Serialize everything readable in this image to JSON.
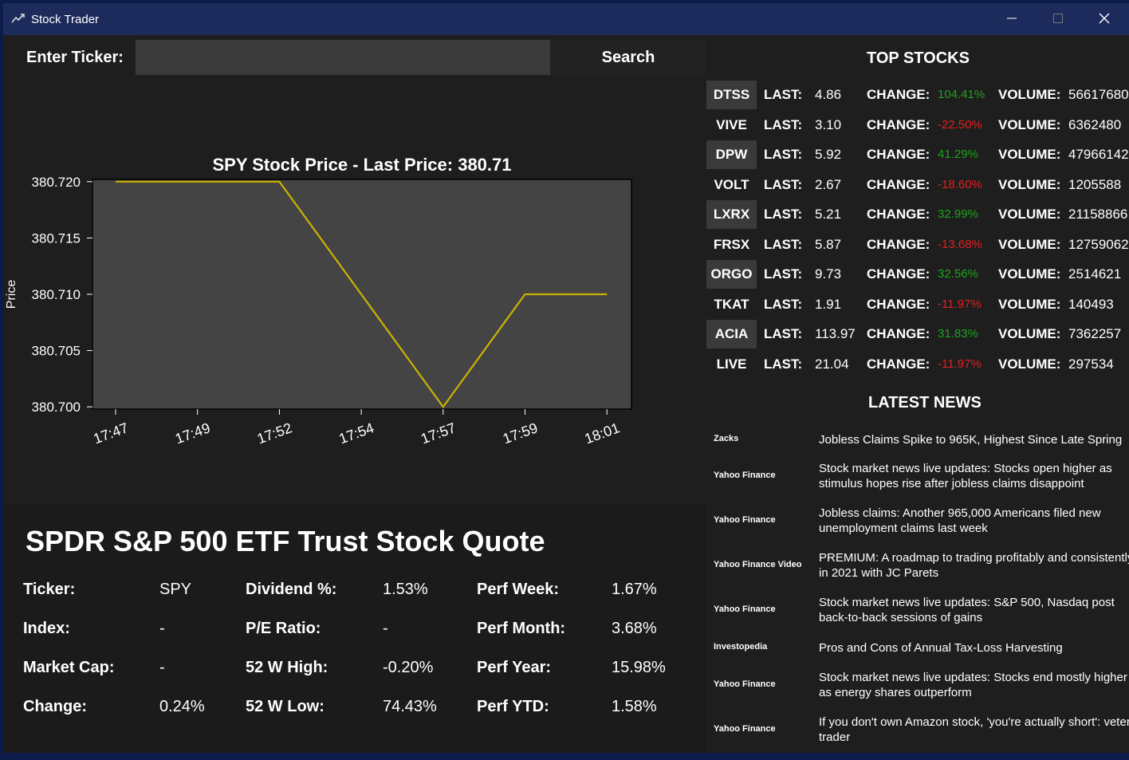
{
  "window": {
    "title": "Stock Trader"
  },
  "search": {
    "label": "Enter Ticker:",
    "value": "",
    "placeholder": "",
    "button": "Search"
  },
  "chart_data": {
    "type": "line",
    "title": "SPY Stock Price - Last Price: 380.71",
    "xlabel": "",
    "ylabel": "Price",
    "x": [
      "17:47",
      "17:49",
      "17:52",
      "17:54",
      "17:57",
      "17:59",
      "18:01"
    ],
    "values": [
      380.72,
      380.72,
      380.72,
      380.71,
      380.7,
      380.71,
      380.71
    ],
    "ylim": [
      380.6998,
      380.7202
    ],
    "yticks": [
      "380.700",
      "380.705",
      "380.710",
      "380.715",
      "380.720"
    ],
    "line_color": "#c8b400",
    "plot_bg": "#444444",
    "grid": false
  },
  "quote": {
    "title": "SPDR S&P 500 ETF Trust Stock Quote",
    "rows": [
      [
        "Ticker:",
        "SPY",
        "Dividend %:",
        "1.53%",
        "Perf Week:",
        "1.67%"
      ],
      [
        "Index:",
        "-",
        "P/E Ratio:",
        "-",
        "Perf Month:",
        "3.68%"
      ],
      [
        "Market Cap:",
        "-",
        "52 W High:",
        "-0.20%",
        "Perf Year:",
        "15.98%"
      ],
      [
        "Change:",
        "0.24%",
        "52 W Low:",
        "74.43%",
        "Perf YTD:",
        "1.58%"
      ]
    ]
  },
  "top_stocks": {
    "title": "TOP STOCKS",
    "last_label": "LAST:",
    "change_label": "CHANGE:",
    "volume_label": "VOLUME:",
    "rows": [
      {
        "symbol": "DTSS",
        "last": "4.86",
        "change": "104.41%",
        "volume": "56617680"
      },
      {
        "symbol": "VIVE",
        "last": "3.10",
        "change": "-22.50%",
        "volume": "6362480"
      },
      {
        "symbol": "DPW",
        "last": "5.92",
        "change": "41.29%",
        "volume": "47966142"
      },
      {
        "symbol": "VOLT",
        "last": "2.67",
        "change": "-18.60%",
        "volume": "1205588"
      },
      {
        "symbol": "LXRX",
        "last": "5.21",
        "change": "32.99%",
        "volume": "21158866"
      },
      {
        "symbol": "FRSX",
        "last": "5.87",
        "change": "-13.68%",
        "volume": "12759062"
      },
      {
        "symbol": "ORGO",
        "last": "9.73",
        "change": "32.56%",
        "volume": "2514621"
      },
      {
        "symbol": "TKAT",
        "last": "1.91",
        "change": "-11.97%",
        "volume": "140493"
      },
      {
        "symbol": "ACIA",
        "last": "113.97",
        "change": "31.83%",
        "volume": "7362257"
      },
      {
        "symbol": "LIVE",
        "last": "21.04",
        "change": "-11.97%",
        "volume": "297534"
      }
    ]
  },
  "news": {
    "title": "LATEST NEWS",
    "items": [
      {
        "source": "Zacks",
        "headline": [
          "Jobless Claims Spike to 965K, Highest Since Late Spring"
        ]
      },
      {
        "source": "Yahoo Finance",
        "headline": [
          "Stock market news live updates: Stocks open higher as",
          "stimulus hopes rise after jobless claims disappoint"
        ]
      },
      {
        "source": "Yahoo Finance",
        "headline": [
          "Jobless claims: Another 965,000 Americans filed new",
          "unemployment claims last week"
        ]
      },
      {
        "source": "Yahoo Finance Video",
        "headline": [
          "PREMIUM: A roadmap to trading profitably and consistently",
          "in 2021 with JC Parets"
        ]
      },
      {
        "source": "Yahoo Finance",
        "headline": [
          "Stock market news live updates: S&P 500, Nasdaq post",
          "back-to-back sessions of gains"
        ]
      },
      {
        "source": "Investopedia",
        "headline": [
          "Pros and Cons of Annual Tax-Loss Harvesting"
        ]
      },
      {
        "source": "Yahoo Finance",
        "headline": [
          "Stock market news live updates: Stocks end mostly higher",
          "as energy shares outperform"
        ]
      },
      {
        "source": "Yahoo Finance",
        "headline": [
          "If you don't own Amazon stock, 'you're actually short': veteran",
          "trader"
        ]
      }
    ]
  },
  "colors": {
    "up": "#1ea31e",
    "down": "#e61e1e",
    "background": "#1e1e1e",
    "titlebar": "#1c2b5c"
  }
}
